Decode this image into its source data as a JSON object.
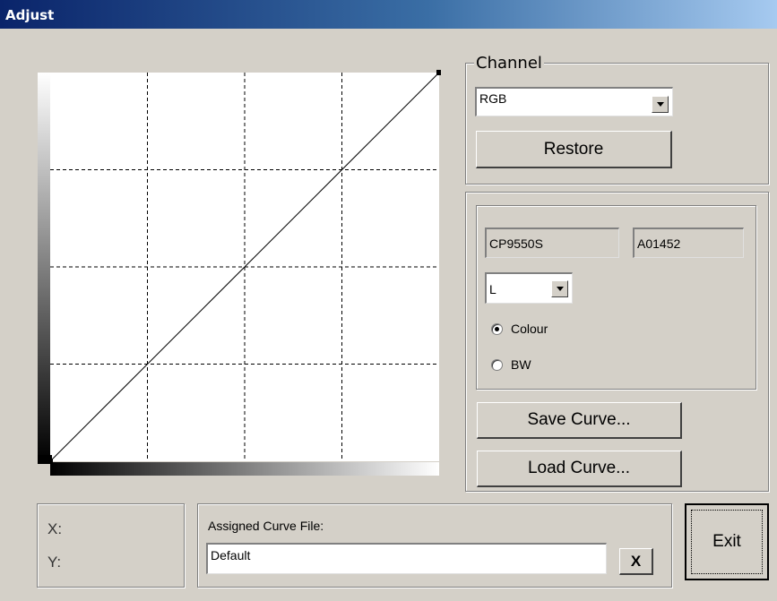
{
  "window": {
    "title": "Adjust"
  },
  "channel": {
    "group_label": "Channel",
    "selected": "RGB",
    "restore_label": "Restore"
  },
  "printer": {
    "model": "CP9550S",
    "serial": "A01452",
    "mode_selected": "L",
    "colour_label": "Colour",
    "bw_label": "BW",
    "selected_radio": "Colour"
  },
  "buttons": {
    "save_curve": "Save Curve...",
    "load_curve": "Load Curve...",
    "exit": "Exit",
    "clear": "X"
  },
  "coords": {
    "x_label": "X:",
    "y_label": "Y:"
  },
  "assigned": {
    "label": "Assigned Curve File:",
    "value": "Default"
  },
  "curve": {
    "points": [
      [
        0,
        0
      ],
      [
        255,
        255
      ]
    ],
    "grid_divisions": 4,
    "range": [
      0,
      255
    ]
  },
  "colors": {
    "title_start": "#0a246a",
    "title_end": "#a6caf0",
    "face": "#d4d0c8"
  }
}
